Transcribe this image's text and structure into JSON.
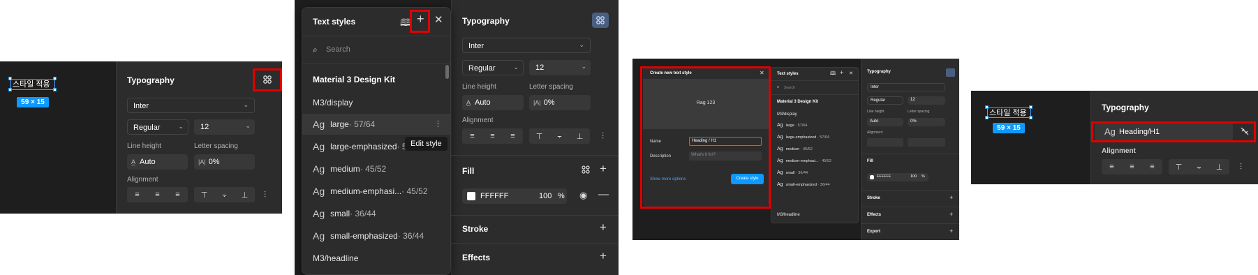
{
  "colors": {
    "panel_bg": "#2c2c2c",
    "canvas_bg": "#1e1e1e",
    "highlight_red": "#e00000",
    "selection_blue": "#0d99ff",
    "create_button_blue": "#0d99ff"
  },
  "step1": {
    "layer_text": "스타일 적용",
    "size_badge": "59 × 15",
    "typography": {
      "title": "Typography",
      "font_family": "Inter",
      "font_weight": "Regular",
      "font_size": "12",
      "line_height_label": "Line height",
      "line_height_value": "Auto",
      "letter_spacing_label": "Letter spacing",
      "letter_spacing_value": "0%",
      "alignment_label": "Alignment",
      "style_icon": "four-dots-icon"
    }
  },
  "step2": {
    "text_styles": {
      "title": "Text styles",
      "search_placeholder": "Search",
      "library_name": "Material 3 Design Kit",
      "group_display": "M3/display",
      "group_headline": "M3/headline",
      "tooltip": "Edit style",
      "items": [
        {
          "ag": "Ag",
          "name": "large",
          "meta": " · 57/64"
        },
        {
          "ag": "Ag",
          "name": "large-emphasized",
          "meta": " · 57/64"
        },
        {
          "ag": "Ag",
          "name": "medium",
          "meta": " · 45/52"
        },
        {
          "ag": "Ag",
          "name": "medium-emphasi...",
          "meta": " · 45/52"
        },
        {
          "ag": "Ag",
          "name": "small",
          "meta": " · 36/44"
        },
        {
          "ag": "Ag",
          "name": "small-emphasized",
          "meta": " · 36/44"
        }
      ]
    },
    "typography": {
      "title": "Typography",
      "font_family": "Inter",
      "font_weight": "Regular",
      "font_size": "12",
      "line_height_label": "Line height",
      "line_height_value": "Auto",
      "letter_spacing_label": "Letter spacing",
      "letter_spacing_value": "0%",
      "alignment_label": "Alignment"
    },
    "fill": {
      "title": "Fill",
      "hex": "FFFFFF",
      "opacity": "100",
      "unit": "%"
    },
    "stroke": {
      "title": "Stroke"
    },
    "effects": {
      "title": "Effects"
    }
  },
  "step3": {
    "dialog": {
      "title": "Create new text style",
      "preview": "Rag 123",
      "name_label": "Name",
      "name_value": "Heading / H1",
      "description_label": "Description",
      "description_placeholder": "What's it for?",
      "show_more": "Show more options",
      "create_button": "Create style"
    },
    "text_styles": {
      "title": "Text styles",
      "search_placeholder": "Search",
      "library_name": "Material 3 Design Kit",
      "group_display": "M3/display",
      "group_headline": "M3/headline",
      "items": [
        {
          "ag": "Ag",
          "name": "large",
          "meta": " · 57/64"
        },
        {
          "ag": "Ag",
          "name": "large-emphasized",
          "meta": " · 57/64"
        },
        {
          "ag": "Ag",
          "name": "medium",
          "meta": " · 45/52"
        },
        {
          "ag": "Ag",
          "name": "medium-emphasi...",
          "meta": " · 45/52"
        },
        {
          "ag": "Ag",
          "name": "small",
          "meta": " · 36/44"
        },
        {
          "ag": "Ag",
          "name": "small-emphasized",
          "meta": " · 36/44"
        }
      ]
    },
    "typography": {
      "title": "Typography",
      "font_family": "Inter",
      "font_weight": "Regular",
      "font_size": "12",
      "line_height_label": "Line height",
      "line_height_value": "Auto",
      "letter_spacing_label": "Letter spacing",
      "letter_spacing_value": "0%",
      "alignment_label": "Alignment"
    },
    "fill": {
      "title": "Fill",
      "hex": "FFFFFF",
      "opacity": "100",
      "unit": "%"
    },
    "stroke": {
      "title": "Stroke"
    },
    "effects": {
      "title": "Effects"
    },
    "export": {
      "title": "Export"
    }
  },
  "step4": {
    "layer_text": "스타일 적용",
    "size_badge": "59 × 15",
    "typography": {
      "title": "Typography",
      "applied_ag": "Ag",
      "applied_style": "Heading/H1",
      "alignment_label": "Alignment",
      "detach_icon": "detach-style-icon"
    }
  }
}
